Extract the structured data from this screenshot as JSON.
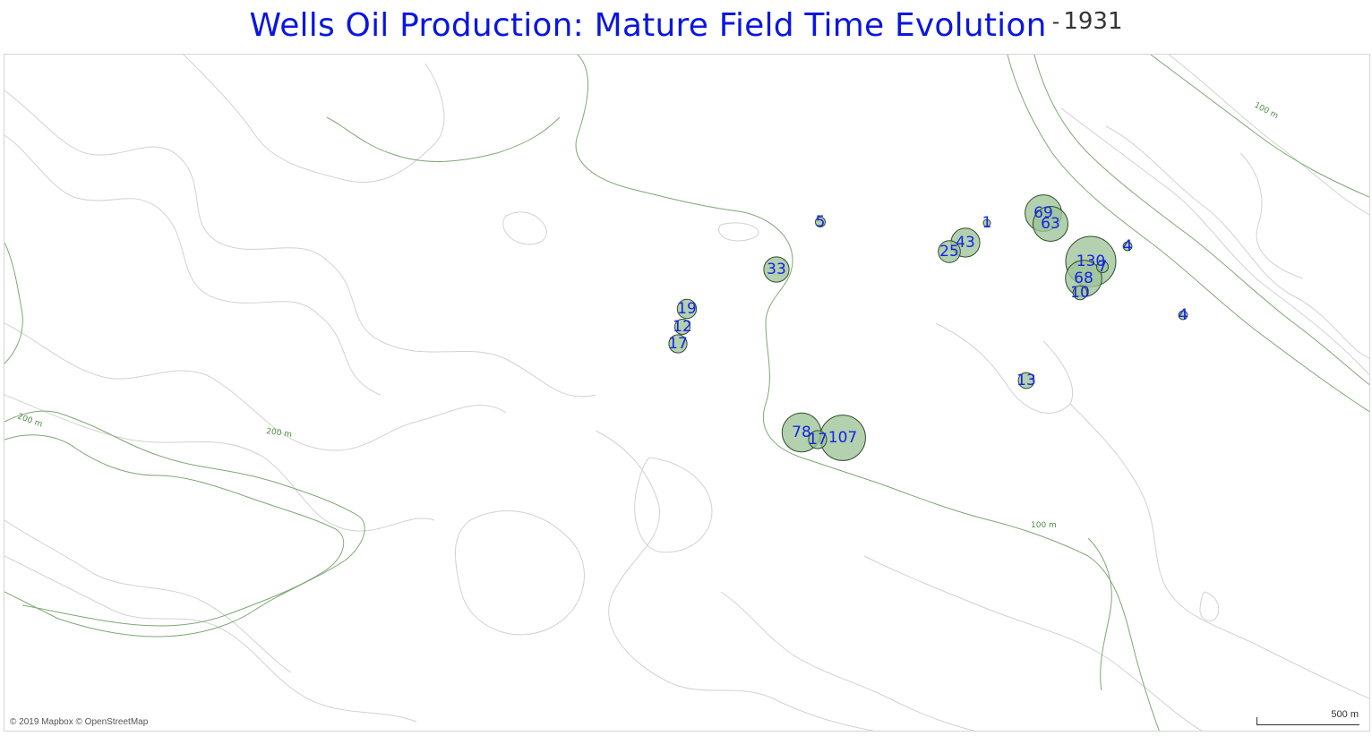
{
  "header": {
    "title": "Wells Oil Production: Mature Field Time Evolution",
    "separator": "-",
    "year": "1931"
  },
  "map": {
    "attribution": "© 2019 Mapbox © OpenStreetMap",
    "scale_label": "500 m",
    "contour_labels": [
      "200 m",
      "200 m",
      "100 m",
      "100 m"
    ],
    "colors": {
      "title": "#0a16e0",
      "well_fill": "#9ec398",
      "well_stroke": "#2f4d2c",
      "well_label": "#1524e8",
      "contour_major": "#7ea874",
      "contour_minor": "#cfd3cf"
    }
  },
  "chart_data": {
    "type": "scatter",
    "title": "Wells Oil Production: Mature Field Time Evolution",
    "year": "1931",
    "size_encoding": "production",
    "wells": [
      {
        "label": "5",
        "value": 5
      },
      {
        "label": "1",
        "value": 1
      },
      {
        "label": "69",
        "value": 69
      },
      {
        "label": "63",
        "value": 63
      },
      {
        "label": "43",
        "value": 43
      },
      {
        "label": "25",
        "value": 25
      },
      {
        "label": "4",
        "value": 4
      },
      {
        "label": "130",
        "value": 130
      },
      {
        "label": "7",
        "value": 7
      },
      {
        "label": "68",
        "value": 68
      },
      {
        "label": "10",
        "value": 10
      },
      {
        "label": "4",
        "value": 4
      },
      {
        "label": "33",
        "value": 33
      },
      {
        "label": "19",
        "value": 19
      },
      {
        "label": "12",
        "value": 12
      },
      {
        "label": "17",
        "value": 17
      },
      {
        "label": "13",
        "value": 13
      },
      {
        "label": "78",
        "value": 78
      },
      {
        "label": "17",
        "value": 17
      },
      {
        "label": "107",
        "value": 107
      }
    ]
  }
}
